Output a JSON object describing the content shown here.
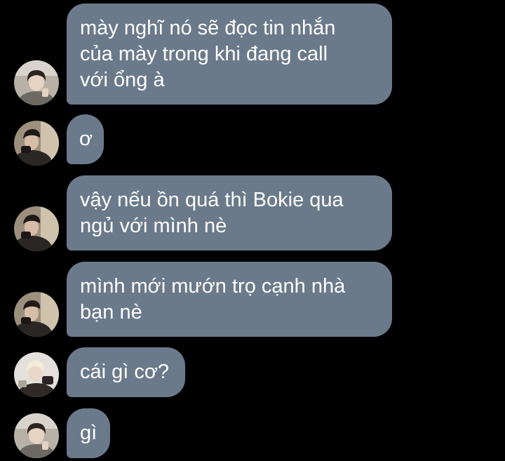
{
  "messages": [
    {
      "avatar_icon": "avatar-icon-dark-hair",
      "lines": [
        "mày nghĩ nó sẽ đọc tin nhắn",
        "của mày trong khi đang call",
        "với ổng à"
      ]
    },
    {
      "avatar_icon": "avatar-icon-cap",
      "lines": [
        "ơ"
      ]
    },
    {
      "avatar_icon": "avatar-icon-cap",
      "lines": [
        "vậy nếu ồn quá thì Bokie qua",
        "ngủ với mình nè"
      ]
    },
    {
      "avatar_icon": "avatar-icon-cap",
      "lines": [
        "mình mới mướn trọ cạnh nhà",
        "bạn nè"
      ]
    },
    {
      "avatar_icon": "avatar-icon-blond",
      "lines": [
        "cái gì cơ?"
      ]
    },
    {
      "avatar_icon": "avatar-icon-dark-hair",
      "lines": [
        "gì"
      ]
    }
  ],
  "colors": {
    "background": "#000000",
    "bubble": "#6a7a8b",
    "text": "#ffffff"
  }
}
